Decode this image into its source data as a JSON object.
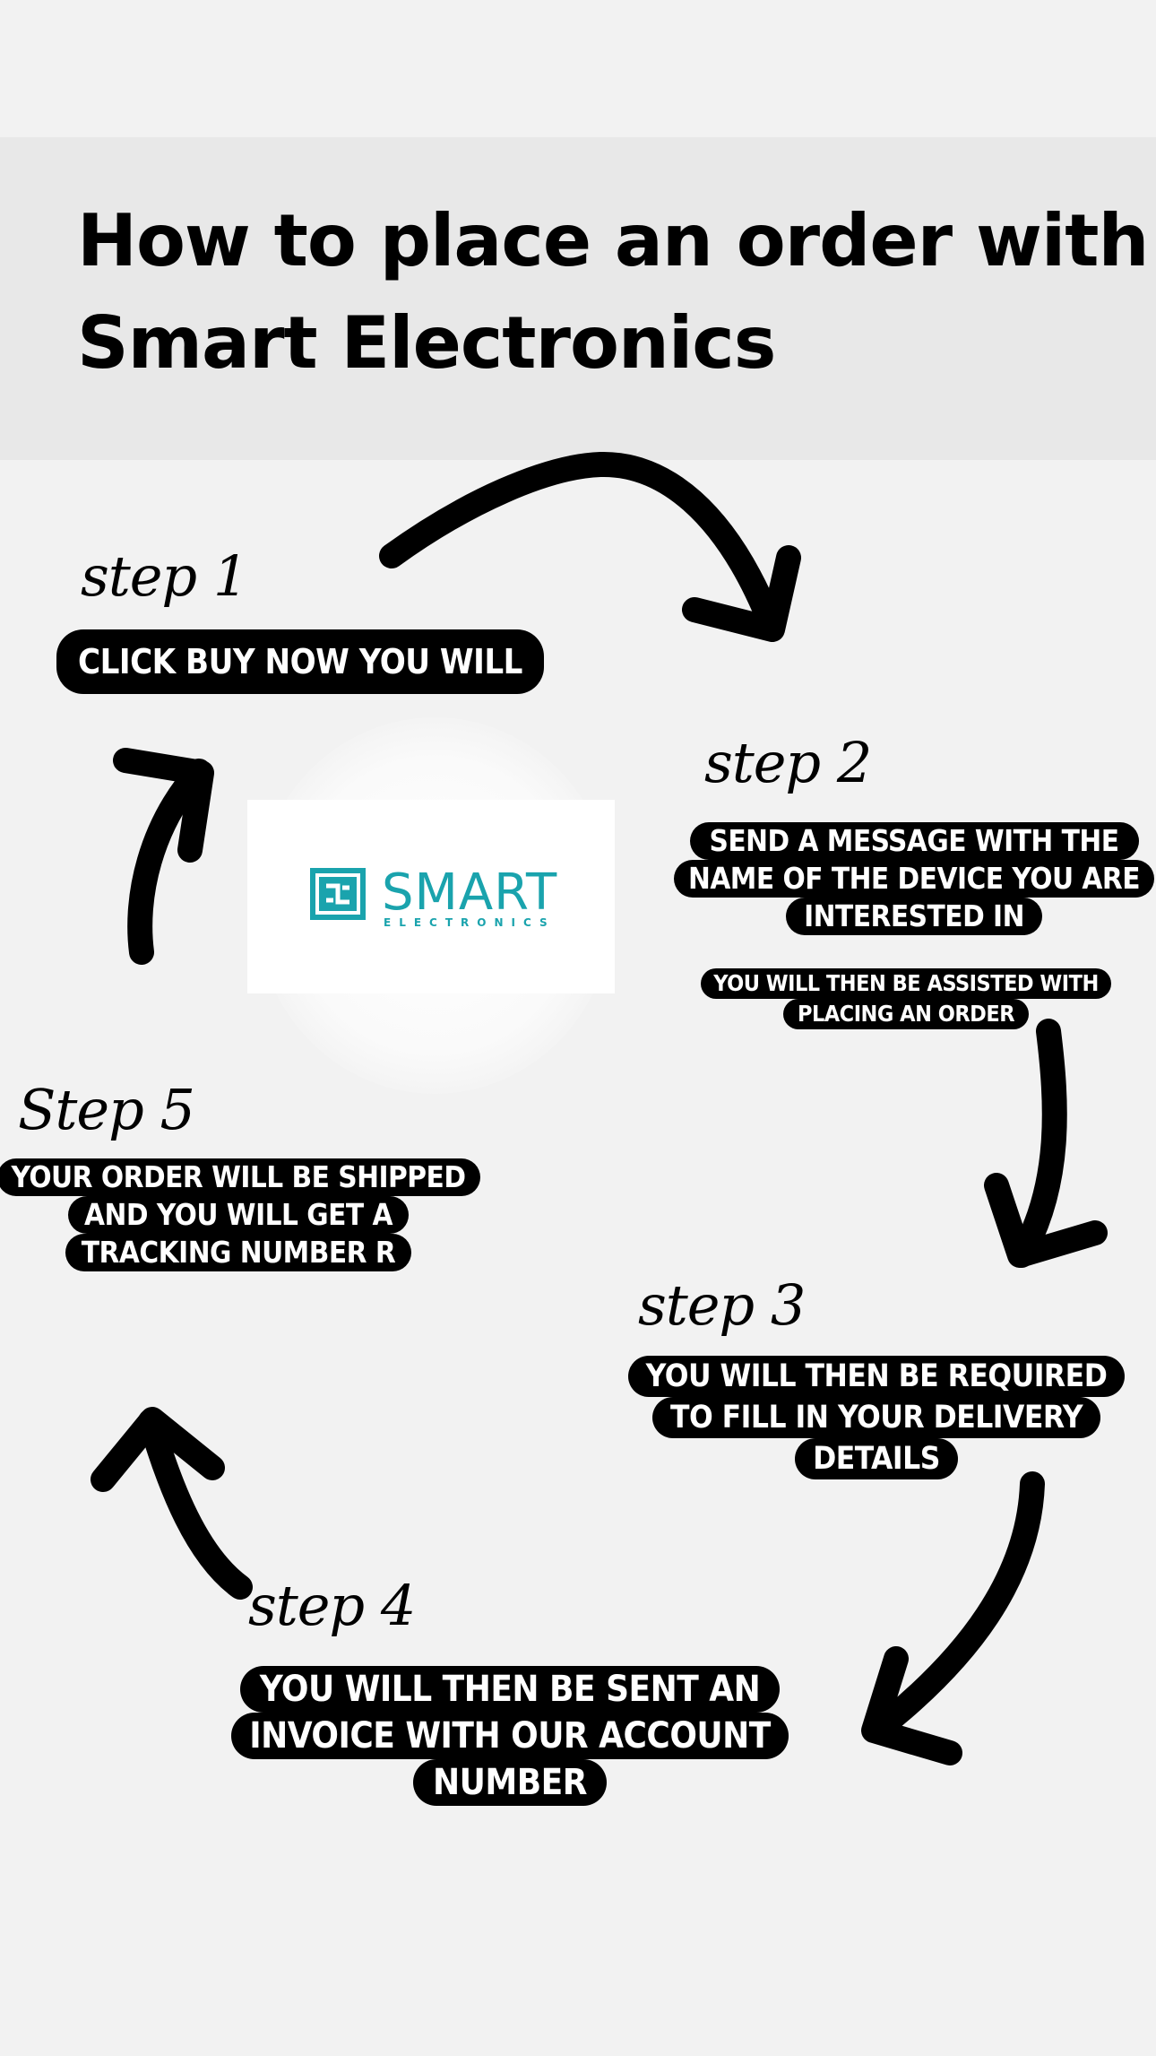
{
  "title": {
    "line1": "How to place an order with",
    "line2": "Smart Electronics"
  },
  "logo": {
    "brand": "SMART",
    "sub": "ELECTRONICS",
    "color": "#1aa3ad"
  },
  "steps": [
    {
      "label": "step 1",
      "lines": [
        "CLICK BUY NOW YOU WILL"
      ]
    },
    {
      "label": "step 2",
      "lines": [
        "SEND A MESSAGE WITH THE",
        "NAME OF THE DEVICE YOU ARE",
        "INTERESTED IN"
      ],
      "note_lines": [
        "YOU WILL THEN BE ASSISTED WITH",
        "PLACING AN ORDER"
      ]
    },
    {
      "label": "step 3",
      "lines": [
        "YOU WILL THEN BE REQUIRED",
        "TO FILL IN YOUR DELIVERY",
        "DETAILS"
      ]
    },
    {
      "label": "step 4",
      "lines": [
        "YOU WILL THEN BE SENT AN",
        "INVOICE WITH OUR ACCOUNT",
        "NUMBER"
      ]
    },
    {
      "label": "Step 5",
      "lines": [
        "YOUR ORDER WILL BE SHIPPED",
        "AND YOU WILL GET A",
        "TRACKING NUMBER R"
      ]
    }
  ]
}
